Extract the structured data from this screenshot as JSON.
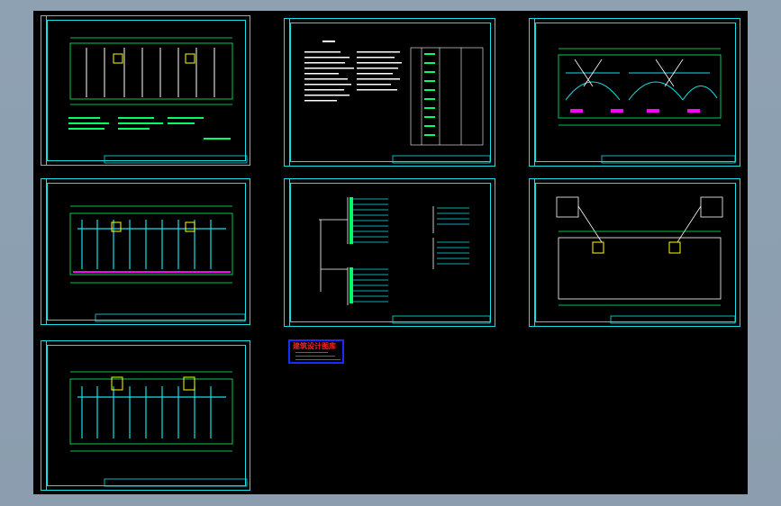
{
  "app": {
    "viewport_background": "#000000",
    "frame_color": "#16e0e6",
    "drawing_color_primary": "#00ff66",
    "drawing_color_secondary": "#ffffff",
    "accent_magenta": "#ff00ff",
    "accent_yellow": "#ffff00"
  },
  "sheets": [
    {
      "id": "plan-top-left",
      "kind": "floor-plan"
    },
    {
      "id": "notes-top-center",
      "kind": "notes-and-table"
    },
    {
      "id": "lighting-top-right",
      "kind": "floor-plan-lighting"
    },
    {
      "id": "power-mid-left",
      "kind": "floor-plan-power"
    },
    {
      "id": "system-mid-center",
      "kind": "system-diagram"
    },
    {
      "id": "roof-mid-right",
      "kind": "roof-plan"
    },
    {
      "id": "plan-bottom-left",
      "kind": "floor-plan"
    }
  ],
  "stamp": {
    "title": "建筑设计图库",
    "border_color": "#1b2bff",
    "text_color": "#ff2020"
  }
}
